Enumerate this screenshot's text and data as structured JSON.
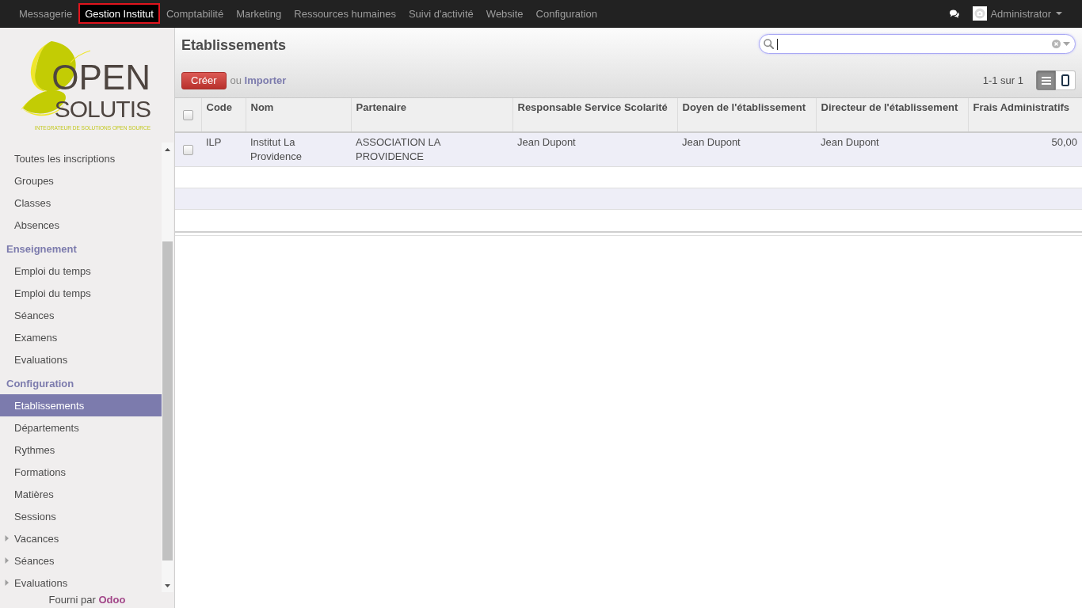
{
  "top_menu": {
    "items": [
      {
        "label": "Messagerie",
        "selected": false
      },
      {
        "label": "Gestion Institut",
        "selected": true
      },
      {
        "label": "Comptabilité",
        "selected": false
      },
      {
        "label": "Marketing",
        "selected": false
      },
      {
        "label": "Ressources humaines",
        "selected": false
      },
      {
        "label": "Suivi d'activité",
        "selected": false
      },
      {
        "label": "Website",
        "selected": false
      },
      {
        "label": "Configuration",
        "selected": false
      }
    ],
    "user": {
      "name": "Administrator"
    }
  },
  "sidebar": {
    "logo": {
      "line_1": "OPEN",
      "line_2": "SOLUTIS",
      "tagline": "INTEGRATEUR DE SOLUTIONS OPEN SOURCE"
    },
    "sections": [
      {
        "items": [
          {
            "label": "Toutes les inscriptions",
            "kind": "link",
            "selected": false
          },
          {
            "label": "Groupes",
            "kind": "link",
            "selected": false
          },
          {
            "label": "Classes",
            "kind": "link",
            "selected": false
          },
          {
            "label": "Absences",
            "kind": "link",
            "selected": false
          }
        ]
      },
      {
        "title": "Enseignement",
        "items": [
          {
            "label": "Emploi du temps",
            "kind": "link",
            "selected": false
          },
          {
            "label": "Emploi du temps",
            "kind": "link",
            "selected": false
          },
          {
            "label": "Séances",
            "kind": "link",
            "selected": false
          },
          {
            "label": "Examens",
            "kind": "link",
            "selected": false
          },
          {
            "label": "Evaluations",
            "kind": "link",
            "selected": false
          }
        ]
      },
      {
        "title": "Configuration",
        "items": [
          {
            "label": "Etablissements",
            "kind": "link",
            "selected": true
          },
          {
            "label": "Départements",
            "kind": "link",
            "selected": false
          },
          {
            "label": "Rythmes",
            "kind": "link",
            "selected": false
          },
          {
            "label": "Formations",
            "kind": "link",
            "selected": false
          },
          {
            "label": "Matières",
            "kind": "link",
            "selected": false
          },
          {
            "label": "Sessions",
            "kind": "link",
            "selected": false
          },
          {
            "label": "Vacances",
            "kind": "folder",
            "expanded": false,
            "selected": false
          },
          {
            "label": "Séances",
            "kind": "folder",
            "expanded": false,
            "selected": false
          },
          {
            "label": "Evaluations",
            "kind": "folder",
            "expanded": false,
            "selected": false
          }
        ]
      }
    ],
    "footer": {
      "text": "Fourni par",
      "link": "Odoo"
    }
  },
  "view": {
    "title": "Etablissements",
    "search": {
      "focused": true
    },
    "create_label": "Créer",
    "import": {
      "text": "ou",
      "link": "Importer"
    },
    "pager": "1-1 sur 1",
    "view_modes": [
      {
        "kind": "list",
        "selected": true
      },
      {
        "kind": "kanban",
        "selected": false
      }
    ]
  },
  "table": {
    "select_all": {
      "checked": false
    },
    "columns": [
      {
        "label": "Code",
        "kind": "text"
      },
      {
        "label": "Nom",
        "kind": "text"
      },
      {
        "label": "Partenaire",
        "kind": "text"
      },
      {
        "label": "Responsable Service Scolarité",
        "kind": "text"
      },
      {
        "label": "Doyen de l'établissement",
        "kind": "text"
      },
      {
        "label": "Directeur de l'établissement",
        "kind": "text"
      },
      {
        "label": "Frais Administratifs",
        "kind": "number"
      }
    ],
    "rows": [
      {
        "checked": false,
        "cells": [
          "ILP",
          "Institut La Providence",
          "ASSOCIATION LA PROVIDENCE",
          "Jean Dupont",
          "Jean Dupont",
          "Jean Dupont",
          "50,00"
        ]
      }
    ]
  }
}
